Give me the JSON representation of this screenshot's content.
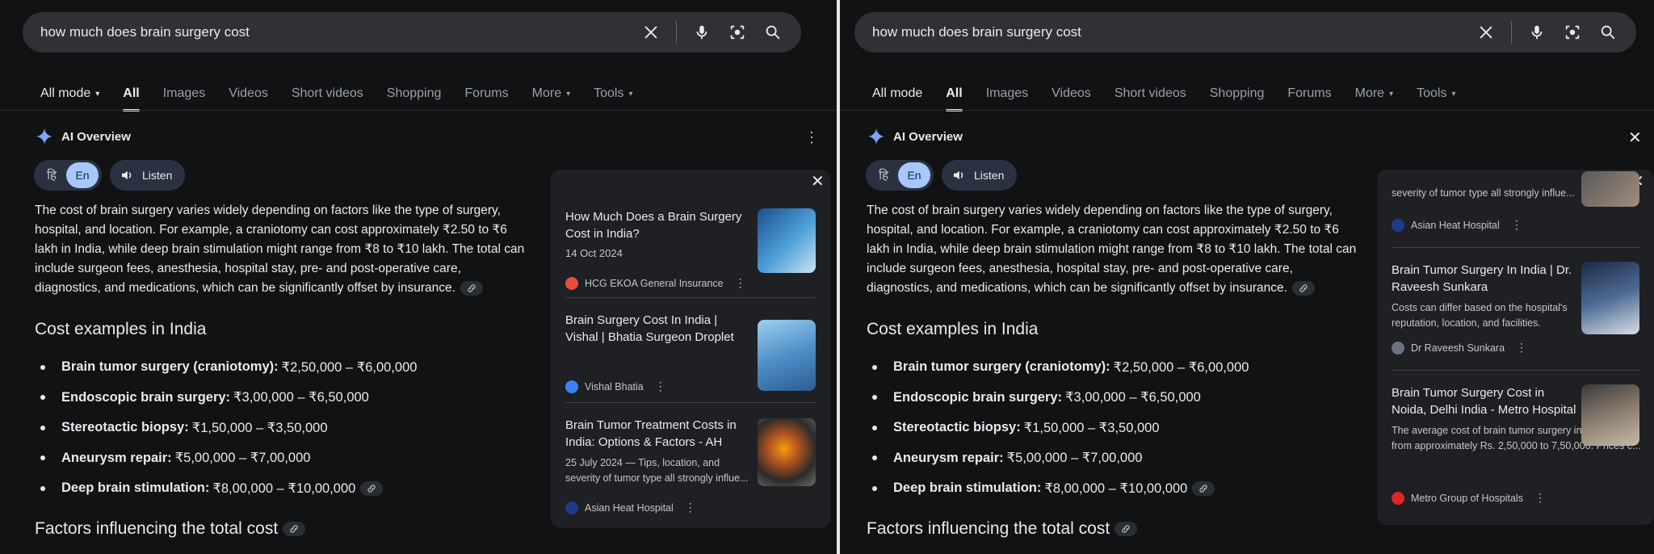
{
  "search": {
    "query": "how much does brain surgery cost",
    "icons": [
      "close-icon",
      "mic-icon",
      "lens-icon",
      "search-icon"
    ]
  },
  "nav": {
    "mode": "All mode",
    "all": "All",
    "images": "Images",
    "videos": "Videos",
    "short_videos": "Short videos",
    "shopping": "Shopping",
    "forums": "Forums",
    "more": "More",
    "tools": "Tools"
  },
  "ai": {
    "title": "AI Overview",
    "lang_hi": "हि",
    "lang_en": "En",
    "listen": "Listen",
    "paragraph": "The cost of brain surgery varies widely depending on factors like the type of surgery, hospital, and location. For example, a craniotomy can cost approximately ₹2.50 to ₹6 lakh in India, while deep brain stimulation might range from ₹8 to ₹10 lakh. The total can include surgeon fees, anesthesia, hospital stay, pre- and post-operative care, diagnostics, and medications, which can be significantly offset by insurance.",
    "cost_heading": "Cost examples in India",
    "costs": [
      {
        "name": "Brain tumor surgery (craniotomy):",
        "range": "₹2,50,000 – ₹6,00,000"
      },
      {
        "name": "Endoscopic brain surgery:",
        "range": "₹3,00,000 – ₹6,50,000"
      },
      {
        "name": "Stereotactic biopsy:",
        "range": "₹1,50,000 – ₹3,50,000"
      },
      {
        "name": "Aneurysm repair:",
        "range": "₹5,00,000 – ₹7,00,000"
      },
      {
        "name": "Deep brain stimulation:",
        "range": "₹8,00,000 – ₹10,00,000"
      }
    ],
    "factors_heading": "Factors influencing the total cost"
  },
  "sources_left": [
    {
      "title": "How Much Does a Brain Surgery Cost in India?",
      "date": "14 Oct 2024",
      "source": "HCG EKOA General Insurance",
      "favicon_color": "#e74c3c"
    },
    {
      "title": "Brain Surgery Cost In India | Vishal | Bhatia Surgeon Droplet",
      "source": "Vishal Bhatia",
      "favicon_color": "#3b82f6"
    },
    {
      "title": "Brain Tumor Treatment Costs in India: Options & Factors - AH",
      "snippet": "25 July 2024 — Tips, location, and severity of tumor type all strongly influe...",
      "source": "Asian Heat Hospital",
      "favicon_color": "#1e3a8a"
    }
  ],
  "sources_right": [
    {
      "snippet": "severity of tumor type all strongly influe...",
      "source": "Asian Heat Hospital",
      "favicon_color": "#1e3a8a"
    },
    {
      "title": "Brain Tumor Surgery In India | Dr. Raveesh Sunkara",
      "snippet": "Costs can differ based on the hospital's reputation, location, and facilities.",
      "source": "Dr Raveesh Sunkara",
      "favicon_color": "#6b7280"
    },
    {
      "title": "Brain Tumor Surgery Cost in Noida, Delhi India - Metro Hospital",
      "snippet": "The average cost of brain tumor surgery in India ranges from approximately Rs. 2,50,000 to 7,50,000. Prices c...",
      "source": "Metro Group of Hospitals",
      "favicon_color": "#dc2626"
    }
  ],
  "colors": {
    "accent": "#a8c7fa",
    "pill": "#2a3242",
    "background": "#111214",
    "card": "#1f2023"
  }
}
